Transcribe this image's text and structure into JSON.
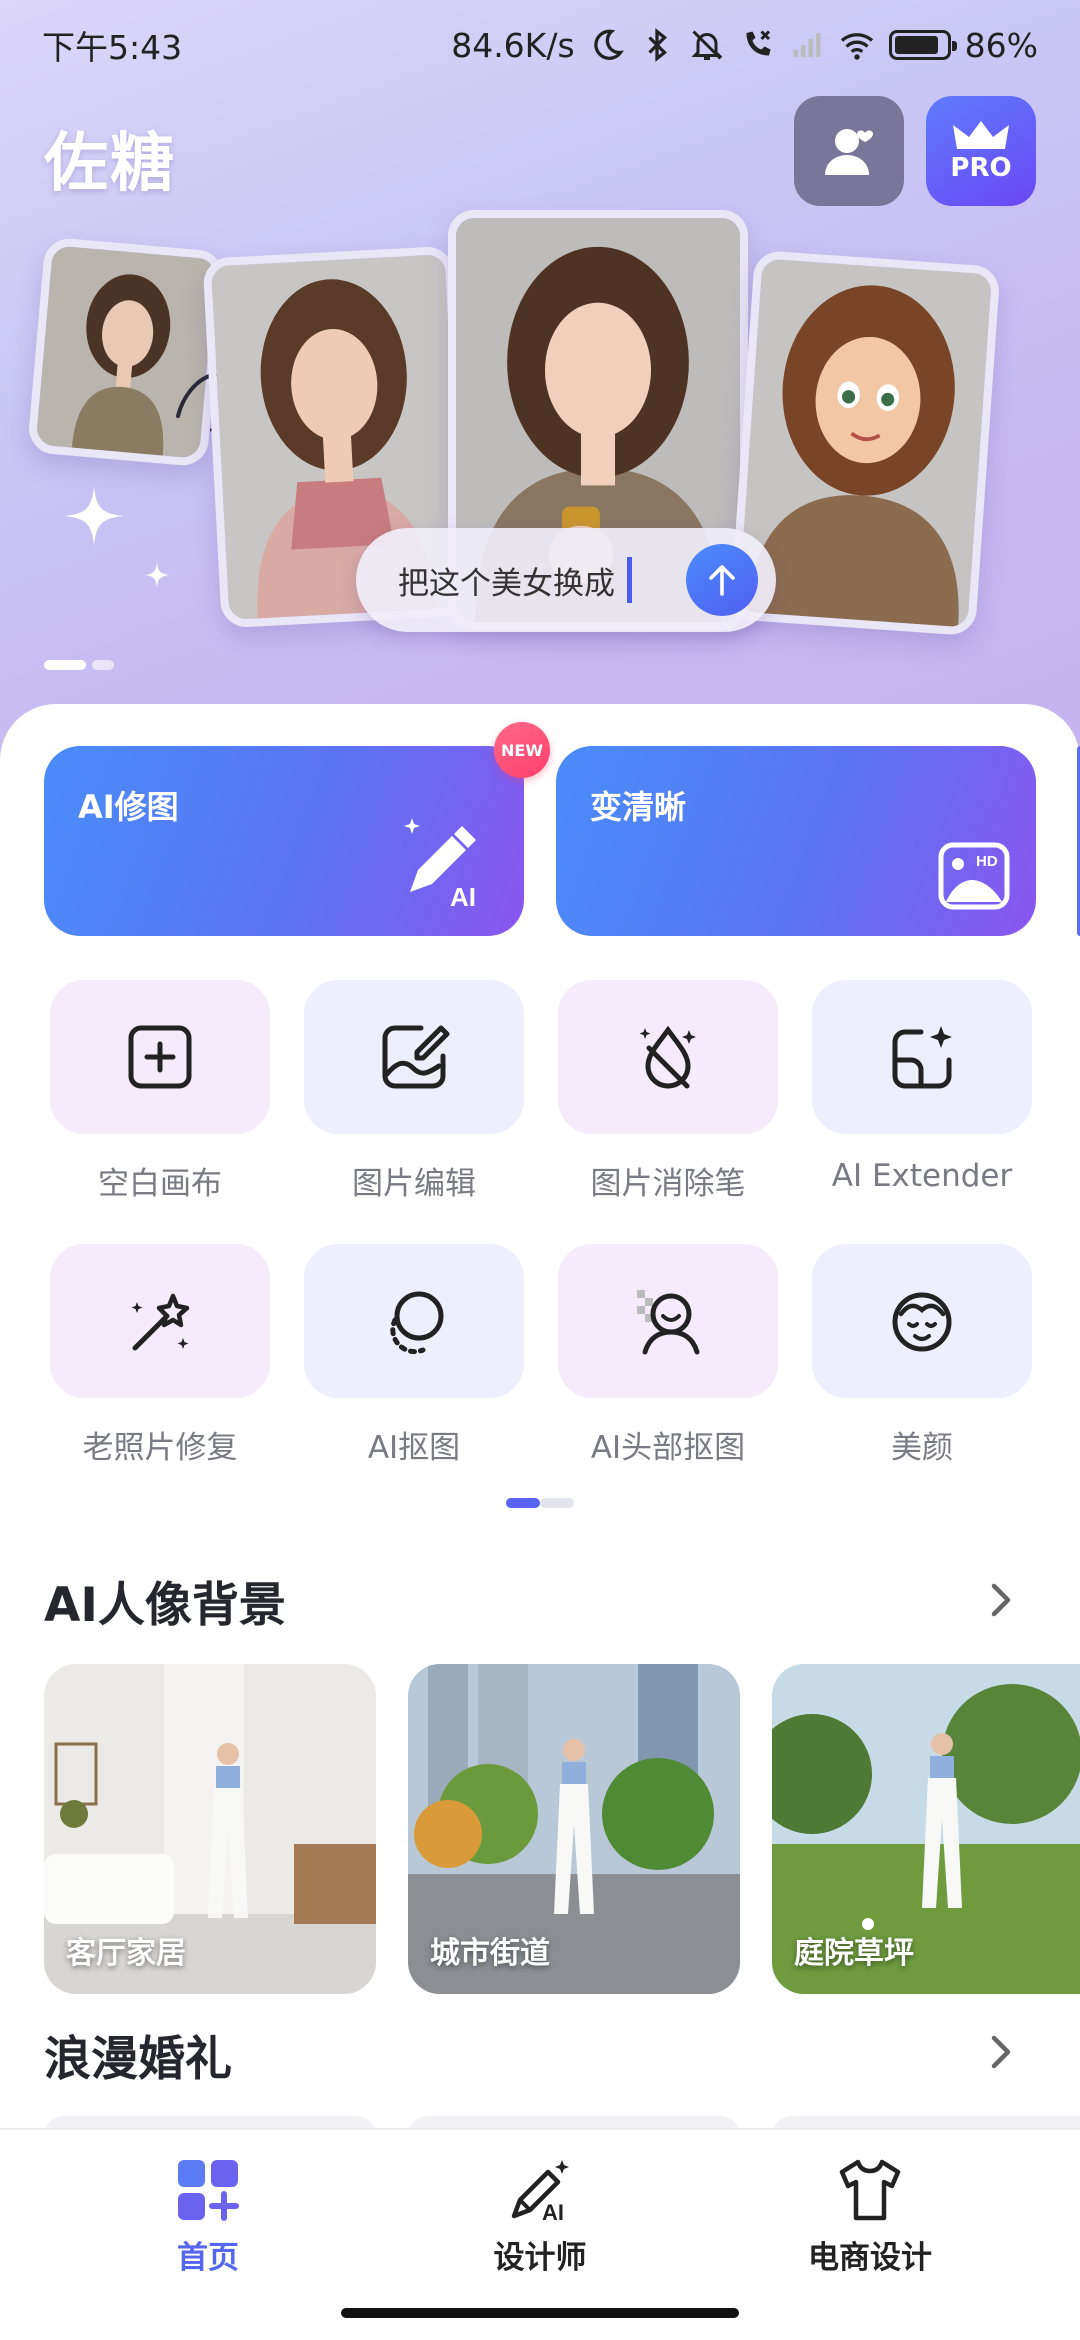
{
  "status_bar": {
    "time": "下午5:43",
    "network_speed": "84.6K/s",
    "battery_percent": "86%",
    "battery_level": 0.86
  },
  "header": {
    "app_title": "佐糖",
    "pro_label": "PRO"
  },
  "hero": {
    "prompt_text": "把这个美女换成",
    "carousel_active_index": 0
  },
  "feature_cards": [
    {
      "label": "AI修图",
      "badge": "NEW"
    },
    {
      "label": "变清晰",
      "icon_badge": "HD"
    }
  ],
  "tools": [
    {
      "label": "空白画布",
      "icon": "blank-canvas-icon"
    },
    {
      "label": "图片编辑",
      "icon": "image-edit-icon"
    },
    {
      "label": "图片消除笔",
      "icon": "eraser-drop-icon"
    },
    {
      "label": "AI Extender",
      "icon": "extender-icon"
    },
    {
      "label": "老照片修复",
      "icon": "magic-wand-icon"
    },
    {
      "label": "AI抠图",
      "icon": "cutout-icon"
    },
    {
      "label": "AI头部抠图",
      "icon": "head-cutout-icon"
    },
    {
      "label": "美颜",
      "icon": "beauty-face-icon"
    }
  ],
  "sections": [
    {
      "title": "AI人像背景",
      "items": [
        {
          "label": "客厅家居"
        },
        {
          "label": "城市街道"
        },
        {
          "label": "庭院草坪"
        }
      ]
    },
    {
      "title": "浪漫婚礼"
    }
  ],
  "tabbar": {
    "tabs": [
      {
        "label": "首页",
        "active": true
      },
      {
        "label": "设计师",
        "active": false
      },
      {
        "label": "电商设计",
        "active": false
      }
    ],
    "active_color": "#5567ee"
  },
  "colors": {
    "accent": "#5567ee",
    "card_gradient_start": "#4a8cf8",
    "card_gradient_end": "#8a56ef",
    "new_badge": "#ff3e6b"
  }
}
